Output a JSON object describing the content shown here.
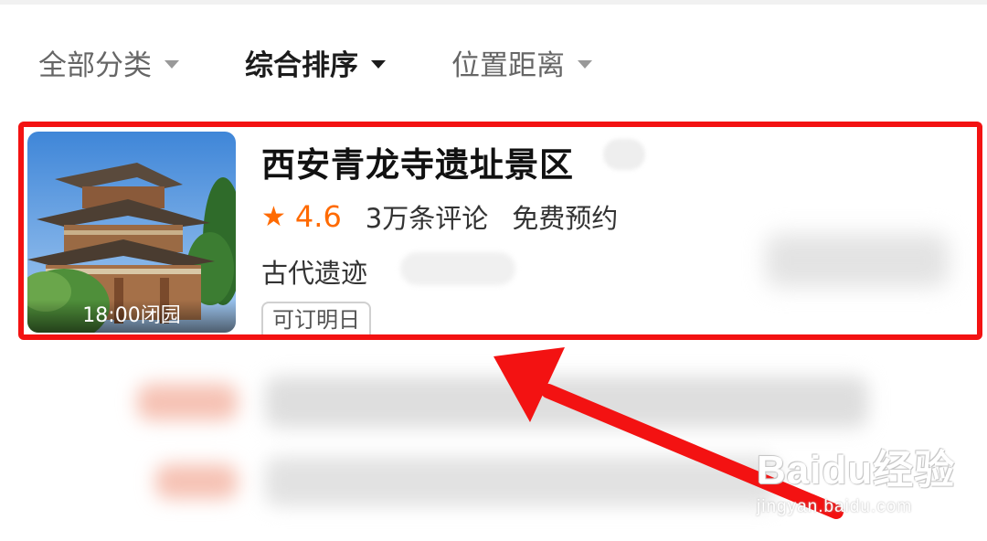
{
  "filters": [
    {
      "label": "全部分类",
      "active": false
    },
    {
      "label": "综合排序",
      "active": true
    },
    {
      "label": "位置距离",
      "active": false
    }
  ],
  "listing": {
    "title": "西安青龙寺遗址景区",
    "rating": "4.6",
    "reviews": "3万条评论",
    "booking_tag": "免费预约",
    "category": "古代遗迹",
    "hours_label": "18:00闭园",
    "chip_label": "可订明日"
  },
  "colors": {
    "accent": "#ff6a00",
    "highlight": "#f31212",
    "arrow": "#f31212"
  },
  "watermark": {
    "logo": "Baidu经验",
    "url": "jingyan.baidu.com"
  },
  "icons": {
    "rating": "star-icon",
    "filter_caret": "caret-down-icon"
  }
}
